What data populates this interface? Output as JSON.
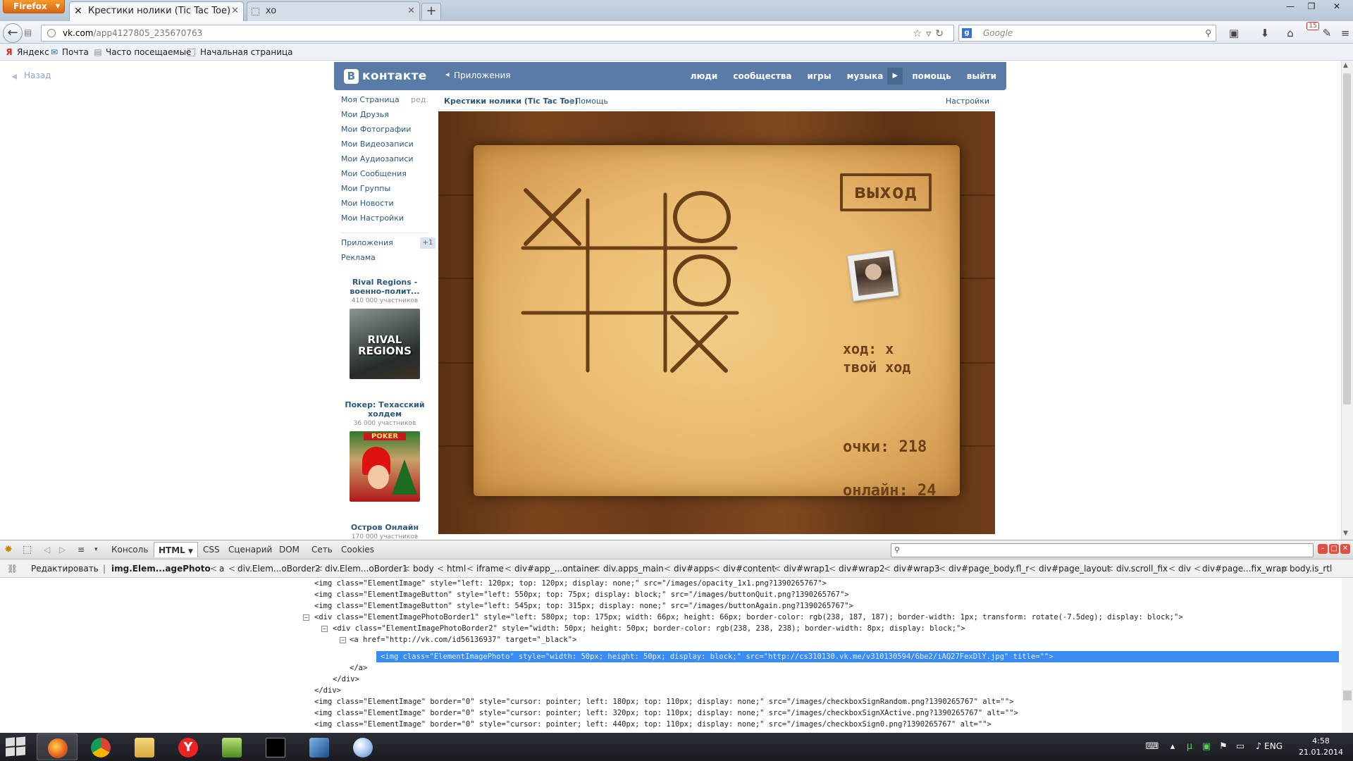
{
  "browser": {
    "menu_button": "Firefox",
    "tabs": [
      {
        "title": "Крестики нолики (Tic Tac Toe)",
        "active": true
      },
      {
        "title": "xo",
        "active": false
      }
    ],
    "new_tab_symbol": "+",
    "url_host": "vk.com",
    "url_path": "/app4127805_235670763",
    "search_placeholder": "Google",
    "notification_count": "15",
    "bookmarks": [
      {
        "label": "Яндекс",
        "icon": "yandex-icon"
      },
      {
        "label": "Почта",
        "icon": "mail-icon"
      },
      {
        "label": "Часто посещаемые",
        "icon": "folder-icon"
      },
      {
        "label": "Начальная страница",
        "icon": "page-icon"
      }
    ]
  },
  "page": {
    "back_link": "Назад",
    "vk_header": {
      "logo_letter": "B",
      "logo_text": "контакте",
      "apps_link": "Приложения",
      "nav": [
        "люди",
        "сообщества",
        "игры",
        "музыка",
        "помощь",
        "выйти"
      ]
    },
    "left_menu": {
      "items": [
        {
          "label": "Моя Страница",
          "aside": "ред."
        },
        {
          "label": "Мои Друзья"
        },
        {
          "label": "Мои Фотографии"
        },
        {
          "label": "Мои Видеозаписи"
        },
        {
          "label": "Мои Аудиозаписи"
        },
        {
          "label": "Мои Сообщения"
        },
        {
          "label": "Мои Группы"
        },
        {
          "label": "Мои Новости"
        },
        {
          "label": "Мои Настройки"
        }
      ],
      "apps": {
        "label": "Приложения",
        "count": "+1"
      },
      "ads_link": "Реклама",
      "ads": [
        {
          "title": "Rival Regions - военно-полит...",
          "subtitle": "410 000 участников",
          "image_text": "RIVAL REGIONS"
        },
        {
          "title": "Покер: Техасский холдем",
          "subtitle": "36 000 участников",
          "image_text": "POKER"
        },
        {
          "title": "Остров Онлайн",
          "subtitle": "170 000 участников"
        }
      ]
    },
    "game": {
      "title": "Крестики нолики (Tic Tac Toe)",
      "separator": "|",
      "help": "Помощь",
      "settings": "Настройки",
      "board": [
        "X",
        "",
        "O",
        "",
        "",
        "O",
        "",
        "",
        "X"
      ],
      "quit_label": "выход",
      "turn_text": "ход: x",
      "turn_sub": "твой ход",
      "score_label": "очки:",
      "score_value": "218",
      "online_label": "онлайн:",
      "online_value": "24"
    }
  },
  "firebug": {
    "tabs": [
      "Консоль",
      "HTML",
      "CSS",
      "Сценарий",
      "DOM",
      "Сеть",
      "Cookies"
    ],
    "active_tab": "HTML",
    "edit_button": "Редактировать",
    "breadcrumbs": [
      "img.Elem...agePhoto",
      "a",
      "div.Elem...oBorder2",
      "div.Elem...oBorder1",
      "body",
      "html",
      "iframe",
      "div#app_...ontainer",
      "div.apps_main",
      "div#apps",
      "div#content",
      "div#wrap1",
      "div#wrap2",
      "div#wrap3",
      "div#page_body.fl_r",
      "div#page_layout",
      "div.scroll_fix",
      "div",
      "div#page...fix_wrap",
      "body.is_rtl"
    ],
    "code_lines": [
      "<img class=\"ElementImage\" style=\"left: 120px; top: 120px; display: none;\" src=\"/images/opacity_1x1.png?1390265767\">",
      "<img class=\"ElementImageButton\" style=\"left: 550px; top: 75px; display: block;\" src=\"/images/buttonQuit.png?1390265767\">",
      "<img class=\"ElementImageButton\" style=\"left: 545px; top: 315px; display: none;\" src=\"/images/buttonAgain.png?1390265767\">",
      "<div class=\"ElementImagePhotoBorder1\" style=\"left: 580px; top: 175px; width: 66px; height: 66px; border-color: rgb(238, 187, 187); border-width: 1px; transform: rotate(-7.5deg); display: block;\">",
      "<div class=\"ElementImagePhotoBorder2\" style=\"width: 50px; height: 50px; border-color: rgb(238, 238, 238); border-width: 8px; display: block;\">",
      "<a href=\"http://vk.com/id56136937\" target=\"_black\">",
      "<img class=\"ElementImagePhoto\" style=\"width: 50px; height: 50px; display: block;\" src=\"http://cs310130.vk.me/v310130594/6be2/iAQ27FexDlY.jpg\" title=\"\">",
      "</a>",
      "</div>",
      "</div>",
      "<img class=\"ElementImage\" border=\"0\" style=\"cursor: pointer; left: 180px; top: 110px; display: none;\" src=\"/images/checkboxSignRandom.png?1390265767\" alt=\"\">",
      "<img class=\"ElementImage\" border=\"0\" style=\"cursor: pointer; left: 320px; top: 110px; display: none;\" src=\"/images/checkboxSignXActive.png?1390265767\" alt=\"\">",
      "<img class=\"ElementImage\" border=\"0\" style=\"cursor: pointer; left: 440px; top: 110px; display: none;\" src=\"/images/checkboxSign0.png?1390265767\" alt=\"\">"
    ]
  },
  "taskbar": {
    "apps": [
      "firefox",
      "chrome",
      "explorer",
      "yandex-browser",
      "notepad-plus",
      "cmd",
      "virtualbox",
      "paint"
    ],
    "active_app": "firefox",
    "language": "ENG",
    "time": "4:58",
    "date": "21.01.2014"
  }
}
